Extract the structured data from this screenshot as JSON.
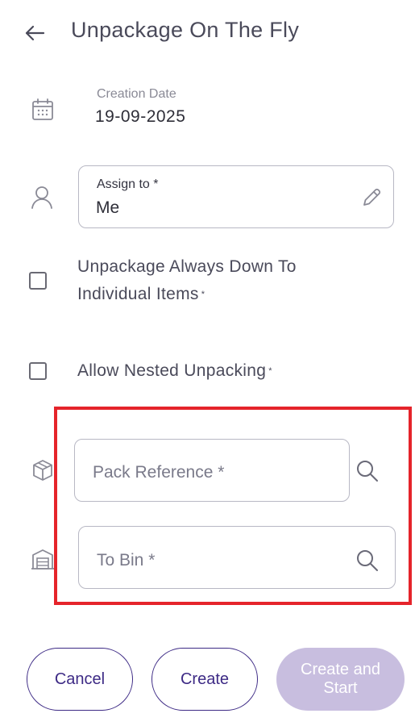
{
  "header": {
    "title": "Unpackage On The Fly",
    "back_icon": "arrow-left-icon"
  },
  "creation": {
    "label": "Creation Date",
    "value": "19-09-2025",
    "icon": "calendar-icon"
  },
  "assign": {
    "label": "Assign to *",
    "value": "Me",
    "icon": "user-icon",
    "edit_icon": "pencil-icon"
  },
  "options": {
    "unpackage_all": {
      "label": "Unpackage Always Down To Individual Items",
      "required_mark": "*",
      "checked": false
    },
    "allow_nested": {
      "label": "Allow Nested Unpacking",
      "required_mark": "*",
      "checked": false
    }
  },
  "pack_reference": {
    "placeholder": "Pack Reference *",
    "icon": "box-icon",
    "search_icon": "search-icon"
  },
  "to_bin": {
    "placeholder": "To Bin *",
    "icon": "warehouse-icon",
    "search_icon": "search-icon"
  },
  "actions": {
    "cancel": "Cancel",
    "create": "Create",
    "create_and_start": "Create and Start"
  },
  "colors": {
    "primary": "#3d2a85",
    "disabled_button": "#c8bedf",
    "highlight": "#e5242b",
    "text": "#4a4a5a"
  }
}
